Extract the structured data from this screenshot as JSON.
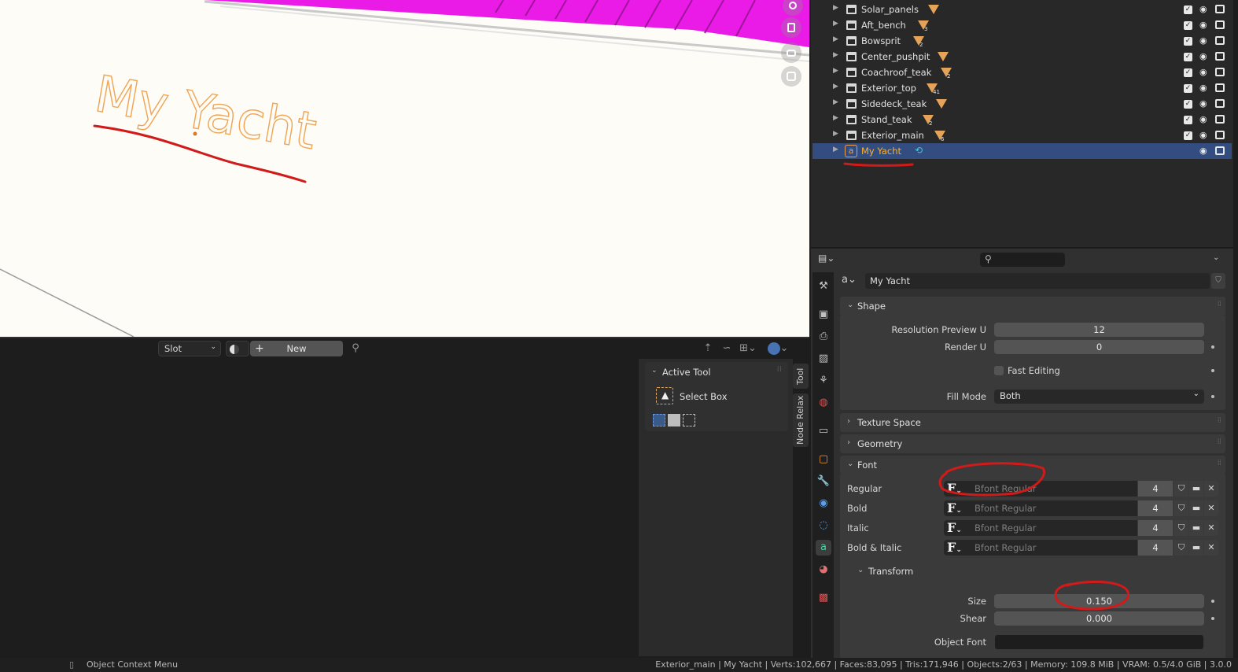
{
  "viewport": {
    "text_object": "My Yacht",
    "nav_icons": [
      "zoom-icon",
      "pan-hand-icon",
      "camera-icon",
      "grid-icon"
    ]
  },
  "editor_header": {
    "slot_label": "Slot",
    "new_label": "New"
  },
  "n_panel": {
    "section": "Active Tool",
    "tool_name": "Select Box",
    "tabs": [
      "Tool",
      "Node Relax"
    ]
  },
  "outliner": {
    "rows": [
      {
        "name": "Solar_panels",
        "badge": ""
      },
      {
        "name": "Aft_bench",
        "badge": "3"
      },
      {
        "name": "Bowsprit",
        "badge": "2"
      },
      {
        "name": "Center_pushpit",
        "badge": ""
      },
      {
        "name": "Coachroof_teak",
        "badge": "2"
      },
      {
        "name": "Exterior_top",
        "badge": "41"
      },
      {
        "name": "Sidedeck_teak",
        "badge": ""
      },
      {
        "name": "Stand_teak",
        "badge": "2"
      },
      {
        "name": "Exterior_main",
        "badge": "6"
      },
      {
        "name": "My Yacht",
        "badge": ""
      }
    ]
  },
  "properties": {
    "object_name": "My Yacht",
    "shape": {
      "title": "Shape",
      "resolution_preview_u_label": "Resolution Preview U",
      "resolution_preview_u": "12",
      "render_u_label": "Render U",
      "render_u": "0",
      "fast_editing_label": "Fast Editing",
      "fill_mode_label": "Fill Mode",
      "fill_mode": "Both"
    },
    "texture_space": "Texture Space",
    "geometry": "Geometry",
    "font": {
      "title": "Font",
      "rows": [
        {
          "label": "Regular",
          "font": "Bfont Regular",
          "users": "4"
        },
        {
          "label": "Bold",
          "font": "Bfont Regular",
          "users": "4"
        },
        {
          "label": "Italic",
          "font": "Bfont Regular",
          "users": "4"
        },
        {
          "label": "Bold & Italic",
          "font": "Bfont Regular",
          "users": "4"
        }
      ]
    },
    "transform": {
      "title": "Transform",
      "size_label": "Size",
      "size": "0.150",
      "shear_label": "Shear",
      "shear": "0.000",
      "object_font_label": "Object Font"
    }
  },
  "status": {
    "left": "Object Context Menu",
    "right": "Exterior_main | My Yacht | Verts:102,667 | Faces:83,095 | Tris:171,946 | Objects:2/63 | Memory: 109.8 MiB | VRAM: 0.5/4.0 GiB | 3.0.0"
  },
  "colors": {
    "accent_selected": "#334d80",
    "active_name": "#ffaf29",
    "annotation": "#d11a1a",
    "magenta_mesh": "#e600e6"
  }
}
